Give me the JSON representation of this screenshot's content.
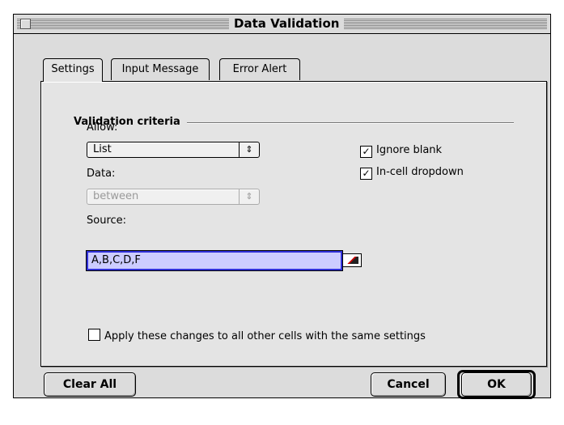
{
  "window": {
    "title": "Data Validation"
  },
  "tabs": [
    {
      "label": "Settings"
    },
    {
      "label": "Input Message"
    },
    {
      "label": "Error Alert"
    }
  ],
  "settings": {
    "section_title": "Validation criteria",
    "allow_label": "Allow:",
    "allow_value": "List",
    "data_label": "Data:",
    "data_value": "between",
    "source_label": "Source:",
    "source_value": "A,B,C,D,F",
    "ignore_blank": {
      "label": "Ignore blank",
      "checked": true
    },
    "in_cell_dropdown": {
      "label": "In-cell dropdown",
      "checked": true
    },
    "apply_all": {
      "label": "Apply these changes to all other cells with the same settings",
      "checked": false
    },
    "select_arrows": "⇕",
    "check_glyph": "✓"
  },
  "buttons": {
    "clear_all": "Clear All",
    "cancel": "Cancel",
    "ok": "OK"
  }
}
